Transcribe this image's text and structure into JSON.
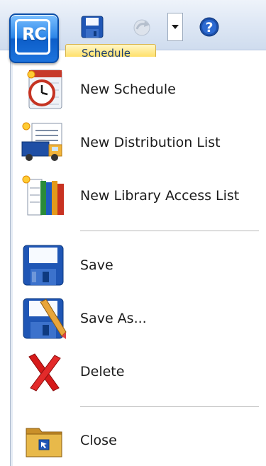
{
  "app_button": {
    "text": "RC"
  },
  "quick_access": {
    "items": [
      {
        "name": "save-icon"
      },
      {
        "name": "redo-icon"
      },
      {
        "name": "customize-dropdown"
      },
      {
        "name": "help-icon"
      }
    ]
  },
  "ribbon": {
    "active_tab": "Schedule"
  },
  "menu": {
    "items": [
      {
        "label": "New Schedule",
        "icon": "new-schedule-icon"
      },
      {
        "label": "New Distribution List",
        "icon": "new-distribution-list-icon"
      },
      {
        "label": "New Library Access List",
        "icon": "new-library-access-list-icon"
      },
      {
        "label": "Save",
        "icon": "save-icon"
      },
      {
        "label": "Save As...",
        "icon": "save-as-icon"
      },
      {
        "label": "Delete",
        "icon": "delete-icon"
      },
      {
        "label": "Close",
        "icon": "close-folder-icon"
      }
    ]
  },
  "colors": {
    "accent_blue": "#2c86e8",
    "tab_yellow": "#ffe06a",
    "delete_red": "#d61a1a"
  }
}
